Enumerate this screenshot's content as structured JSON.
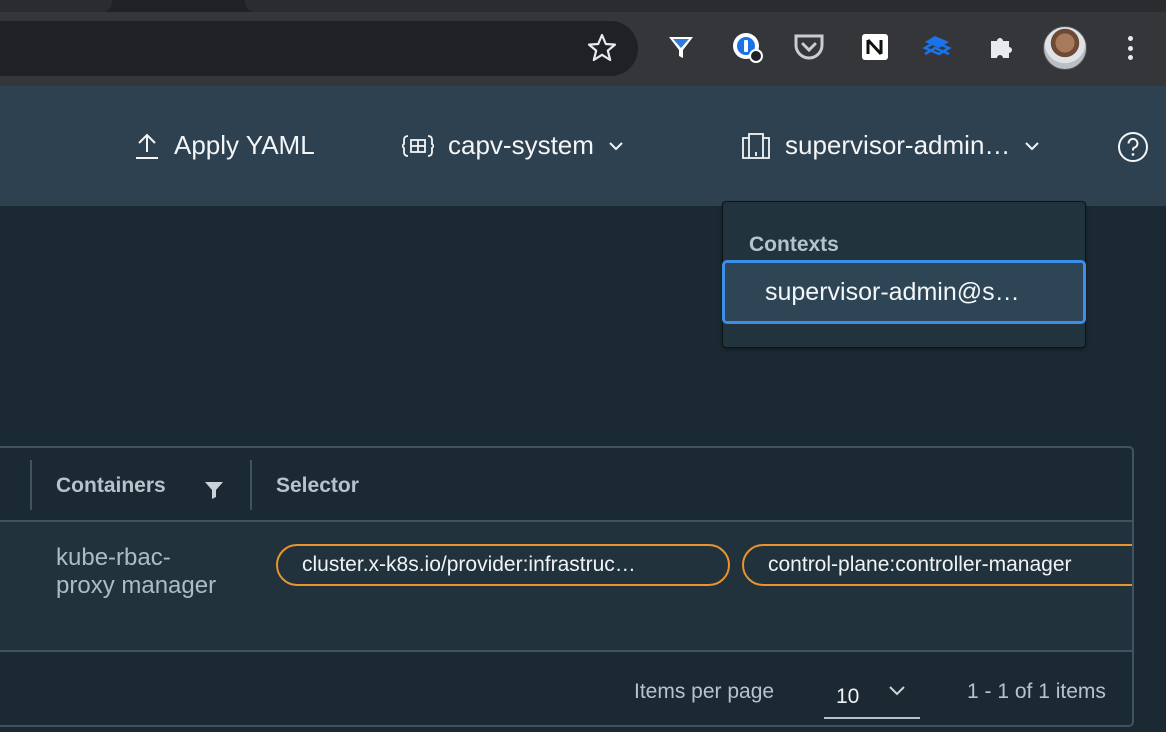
{
  "header": {
    "apply_yaml_label": "Apply YAML",
    "namespace_label": "capv-system",
    "context_label": "supervisor-admin…"
  },
  "contexts_menu": {
    "heading": "Contexts",
    "items": [
      {
        "label": "supervisor-admin@s…",
        "selected": true
      }
    ]
  },
  "grid": {
    "columns": [
      "Containers",
      "Selector"
    ],
    "rows": [
      {
        "containers": "kube-rbac-proxy manager",
        "selector": [
          "cluster.x-k8s.io/provider:infrastruc…",
          "control-plane:controller-manager"
        ]
      }
    ],
    "footer": {
      "items_per_page_label": "Items per page",
      "items_per_page_value": "10",
      "count_text": "1 - 1 of 1 items"
    }
  },
  "colors": {
    "header_bg": "#2e4150",
    "page_bg": "#1b2a32",
    "selected_border": "#3d8ee8",
    "chip_border": "#e8952c"
  },
  "icons": {
    "toolbar": [
      "star-icon",
      "ad-blocker-extension-icon",
      "password-manager-extension-icon",
      "pocket-extension-icon",
      "notion-extension-icon",
      "sync-extension-icon",
      "extensions-puzzle-icon",
      "profile-avatar",
      "menu-kebab-icon"
    ],
    "header": [
      "upload-icon",
      "namespace-icon",
      "context-icon",
      "help-icon"
    ]
  }
}
